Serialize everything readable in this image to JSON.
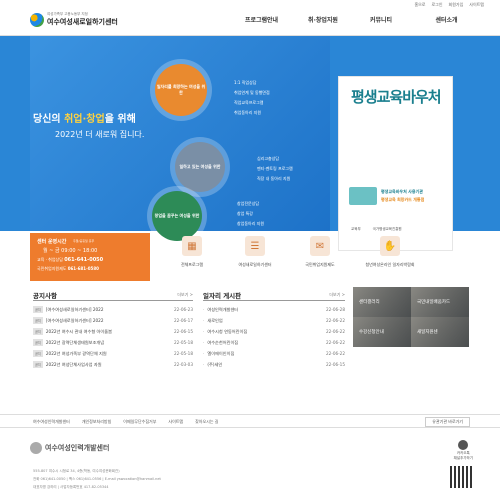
{
  "util": [
    "홈으로",
    "로그인",
    "회원가입",
    "사이트맵"
  ],
  "logo": {
    "sub": "여성가족부 고용노동부 지정",
    "name": "여수여성새로일하기센터"
  },
  "gnb": [
    "프로그램안내",
    "취·창업지원",
    "커뮤니티",
    "센터소개"
  ],
  "hero": {
    "head_pre": "당신의 ",
    "head_em": "취업·창업",
    "head_post": "을 위해",
    "sub": "2022년 더 새로워 집니다.",
    "circle1": "일자리를 희망하는 여성을 위한",
    "circle2": "일하고 있는 여성을 위한",
    "circle3": "창업을 꿈꾸는 여성을 위한",
    "list1": [
      "1:1 직업상담",
      "취업연계 및 동행면접",
      "직업교육프로그램",
      "취업동아리 지원"
    ],
    "list2": [
      "심리고충상담",
      "멘티·멘토링 프로그램",
      "직장 내 동아리 지원"
    ],
    "list3": [
      "창업전문상담",
      "창업 특강",
      "창업동아리 지원"
    ]
  },
  "promo": {
    "big": "평생교육바우처",
    "t1": "평생교육바우처 사용기관",
    "t2": "평생교육 희망카드 개통점",
    "orgs": [
      "교육부",
      "국가평생교육진흥원"
    ]
  },
  "center": {
    "title": "센터 운영시간",
    "title_note": "주말/공휴일 휴무",
    "hours": "월 ~ 금 09:00 ~ 18:00",
    "phone_label": "교육 · 취업상담",
    "phone": "061-641-0050",
    "phone2_label": "국민취업지원제도",
    "phone2": "061-681-0580"
  },
  "quick": [
    {
      "icon": "▦",
      "label": "전체프로그램"
    },
    {
      "icon": "☰",
      "label": "여성새로일하기센터"
    },
    {
      "icon": "✉",
      "label": "국민취업지원제도"
    },
    {
      "icon": "✋",
      "label": "청년여성온라인 일자리박람회"
    }
  ],
  "notice": {
    "title": "공지사항",
    "more": "더보기 >",
    "rows": [
      {
        "tag": "공지",
        "text": "[여수여성새로일하기센터] 2022",
        "date": "22-06-23"
      },
      {
        "tag": "공지",
        "text": "[여수여성새로일하기센터] 2022",
        "date": "22-06-17"
      },
      {
        "tag": "공지",
        "text": "2022년 여수시 관내 여수형 아이돌봄",
        "date": "22-06-15"
      },
      {
        "tag": "공지",
        "text": "2022년 광역단체생태원보조개념",
        "date": "22-05-18"
      },
      {
        "tag": "공지",
        "text": "2022년 여성가족부 광역단체 지원",
        "date": "22-05-18"
      },
      {
        "tag": "공지",
        "text": "2022년 여성단체사업사업 자원",
        "date": "22-03-03"
      }
    ]
  },
  "jobs": {
    "title": "일자리 게시판",
    "more": "더보기 >",
    "rows": [
      {
        "text": "여성인력개발센터",
        "date": "22-06-28"
      },
      {
        "text": "새로인업",
        "date": "22-06-22"
      },
      {
        "text": "여수시청 연동어린이집",
        "date": "22-06-22"
      },
      {
        "text": "여수순천어린이집",
        "date": "22-06-22"
      },
      {
        "text": "엘이에이인이집",
        "date": "22-06-22"
      },
      {
        "text": "(주)세인",
        "date": "22-06-15"
      }
    ]
  },
  "tiles": [
    "센터갤러리",
    "국민내일배움카드",
    "수강신청안내",
    "새일지원센"
  ],
  "footer_links": [
    "여수여성인력개발센터",
    "개인정보처리방침",
    "이메일무단수집거부",
    "사이트맵",
    "찾아오시는 길"
  ],
  "family_site": "유관기관 바로가기",
  "footer": {
    "name": "여수여성인력개발센터",
    "addr1": "555-807 여수시 시청로 34, 4층(학동, 여수여성문화회관)",
    "addr2": "전화 061)641-0050 | 팩스 061)641-0556 | E-mail yswocation@hanmail.net",
    "addr3": "대표자명 강하리 | 사업자등록번호 417-82-05344",
    "kakao": "카카오톡",
    "kakao_sub": "채널추가하기"
  }
}
